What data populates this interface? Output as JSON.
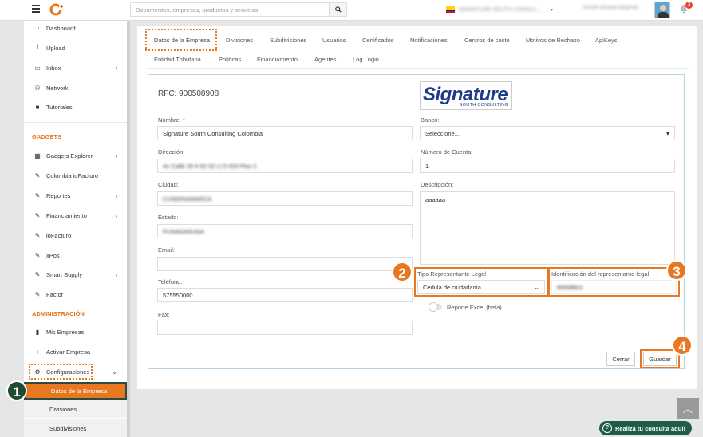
{
  "topbar": {
    "search_placeholder": "Documentos, empresas, productos y servicios",
    "company": "SIGNATURE SOUTH CONSUL...",
    "user_email": "maultl.vasquez@gmai...",
    "notifications_count": "3"
  },
  "sidebar": {
    "items": [
      {
        "label": "Dashboard"
      },
      {
        "label": "Upload"
      },
      {
        "label": "Inbox"
      },
      {
        "label": "Network"
      },
      {
        "label": "Tutoriales"
      }
    ],
    "gadgets_title": "GADGETS",
    "gadgets": [
      {
        "label": "Gadgets Explorer"
      },
      {
        "label": "Colombia ioFacturo"
      },
      {
        "label": "Reportes"
      },
      {
        "label": "Financiamiento"
      },
      {
        "label": "ioFacturo"
      },
      {
        "label": "xPos"
      },
      {
        "label": "Smart Supply"
      },
      {
        "label": "Factor"
      }
    ],
    "admin_title": "ADMINISTRACIÓN",
    "admin": [
      {
        "label": "Mis Empresas"
      },
      {
        "label": "Activar Empresa"
      },
      {
        "label": "Configuraciones"
      }
    ],
    "subitems": [
      {
        "label": "Datos de la Empresa"
      },
      {
        "label": "Divisiones"
      },
      {
        "label": "Subdivisiones"
      }
    ]
  },
  "tabs": {
    "row1": [
      "Datos de la Empresa",
      "Divisiones",
      "Subdivisiones",
      "Usuarios",
      "Certificados",
      "Notificaciones",
      "Centros de costo",
      "Motivos de Rechazo",
      "ApiKeys"
    ],
    "row2": [
      "Entidad Tributaria",
      "Políticas",
      "Financiamiento",
      "Agentes",
      "Log Login"
    ]
  },
  "form": {
    "rfc_label": "RFC: 900508908",
    "logo_big": "Signature",
    "logo_small": "SOUTH CONSULTING",
    "nombre_label": "Nombre:",
    "nombre_req": "*",
    "nombre_value": "Signature South Consulting Colombia",
    "direccion_label": "Dirección:",
    "direccion_value": "Av Calle 26 # 92-32 Lt 5 IO3 Piso 2",
    "ciudad_label": "Ciudad:",
    "ciudad_value": "CUNDINAMARCA",
    "estado_label": "Estado:",
    "estado_value": "FUSAGASUGA",
    "email_label": "Email:",
    "email_value": "",
    "telefono_label": "Teléfono:",
    "telefono_value": "575550000",
    "fax_label": "Fax:",
    "fax_value": "",
    "banco_label": "Banco:",
    "banco_value": "Seleccione...",
    "cuenta_label": "Número de Cuenta:",
    "cuenta_value": "1",
    "descripcion_label": "Descripción:",
    "descripcion_value": "aaaaaa",
    "tipo_rep_label": "Tipo Representante Legal",
    "tipo_rep_value": "Cédula de ciudadanía",
    "id_rep_label": "Identificación del representante legal",
    "id_rep_value": "80508811",
    "reporte_excel_label": "Reporte Excel (beta)",
    "cerrar_label": "Cerrar",
    "guardar_label": "Guardar"
  },
  "annotations": [
    "1",
    "2",
    "3",
    "4"
  ],
  "help_label": "Realiza tu consulta aquí!",
  "colors": {
    "accent": "#e87722",
    "dark_green": "#1f5d47",
    "card_border": "#b9d3e6"
  }
}
